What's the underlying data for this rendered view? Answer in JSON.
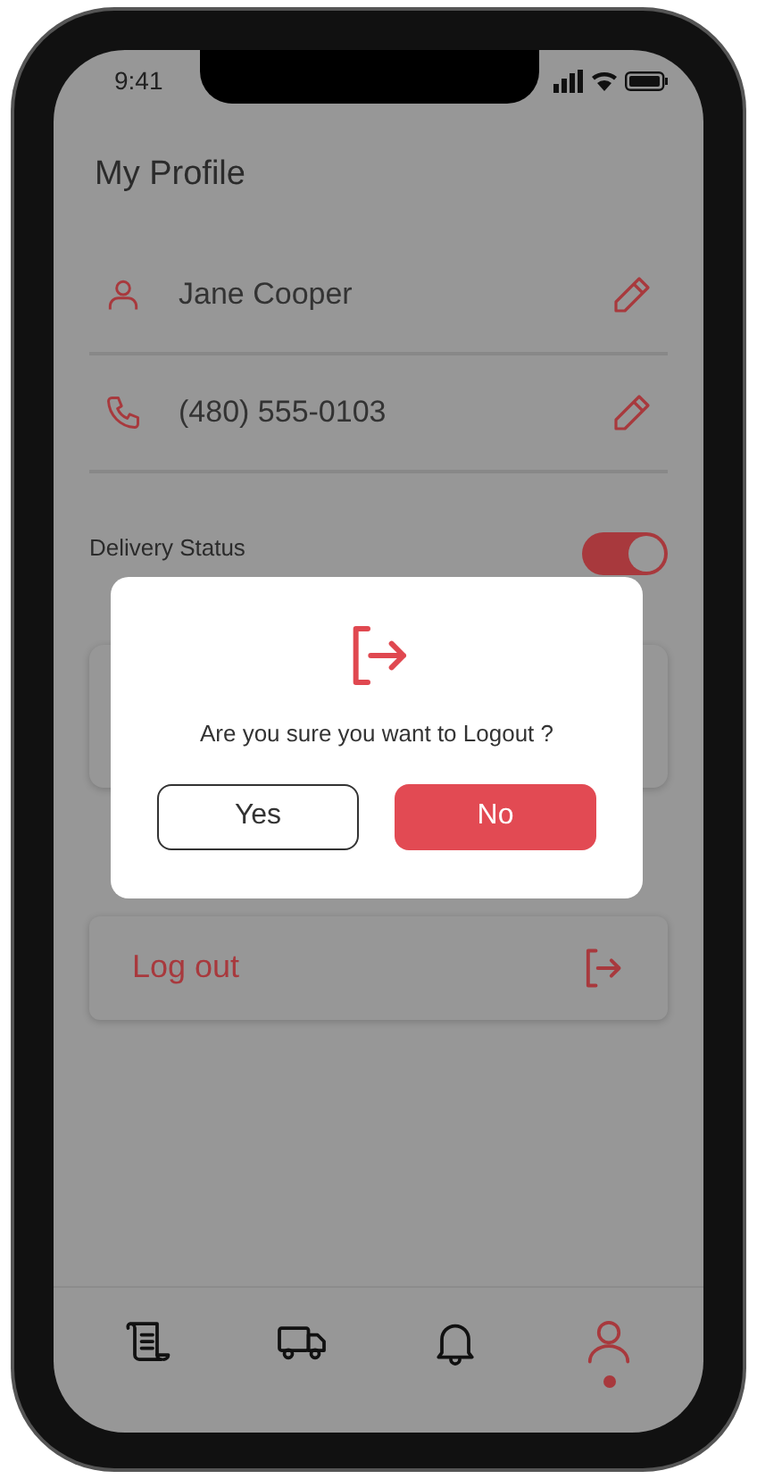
{
  "status_bar": {
    "time": "9:41"
  },
  "title": "My Profile",
  "fields": [
    {
      "kind": "name",
      "value": "Jane Cooper"
    },
    {
      "kind": "phone",
      "value": "(480) 555-0103"
    }
  ],
  "delivery_status": {
    "label": "Delivery Status",
    "on": true
  },
  "logout_item": {
    "label": "Log out"
  },
  "dialog": {
    "message": "Are you sure you want to Logout ?",
    "buttons": [
      {
        "label": "Yes",
        "kind": "outline"
      },
      {
        "label": "No",
        "kind": "filled"
      }
    ]
  },
  "bottom_nav": [
    {
      "kind": "orders",
      "selected": false
    },
    {
      "kind": "delivery",
      "selected": false
    },
    {
      "kind": "notifications",
      "selected": false
    },
    {
      "kind": "profile",
      "selected": true
    }
  ]
}
